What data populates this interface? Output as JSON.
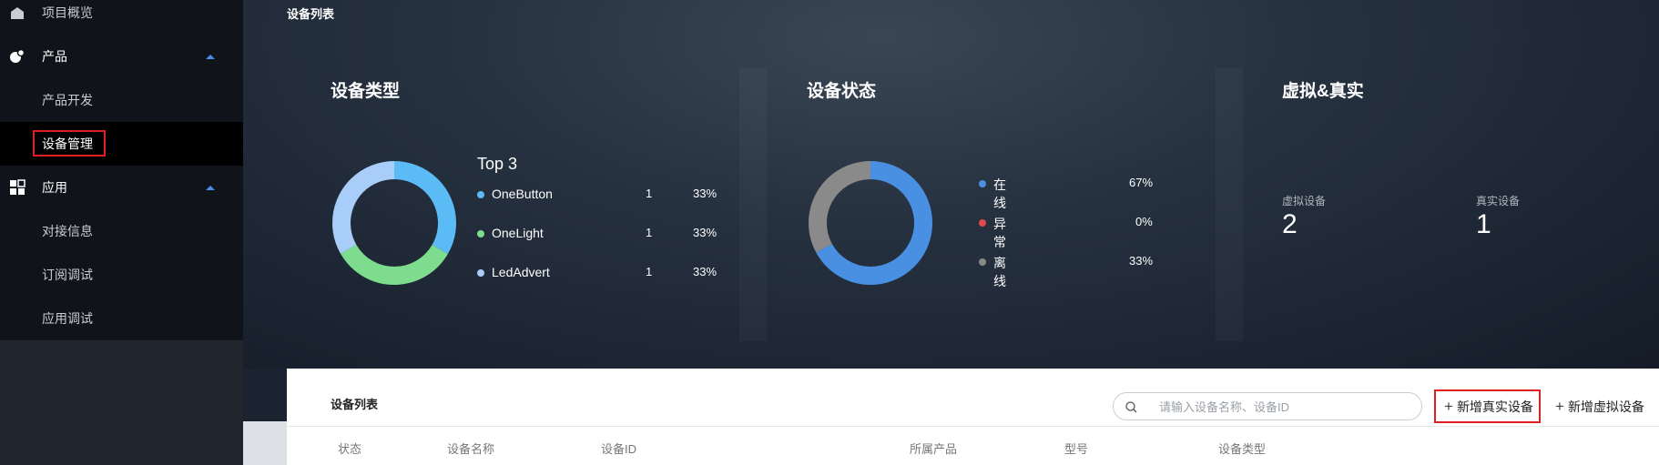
{
  "sidebar": {
    "items": [
      {
        "label": "项目概览",
        "icon": "home-icon",
        "kind": "item"
      },
      {
        "label": "产品",
        "icon": "product-icon",
        "kind": "group"
      },
      {
        "label": "产品开发",
        "kind": "sub"
      },
      {
        "label": "设备管理",
        "kind": "sub",
        "active": true
      },
      {
        "label": "应用",
        "icon": "apps-icon",
        "kind": "group"
      },
      {
        "label": "对接信息",
        "kind": "sub"
      },
      {
        "label": "订阅调试",
        "kind": "sub"
      },
      {
        "label": "应用调试",
        "kind": "sub"
      }
    ]
  },
  "hero": {
    "title": "设备列表",
    "device_type": {
      "title": "设备类型",
      "top_label": "Top 3",
      "legend": [
        {
          "name": "OneButton",
          "count": "1",
          "pct": "33%",
          "color": "#5bbcf5"
        },
        {
          "name": "OneLight",
          "count": "1",
          "pct": "33%",
          "color": "#7edc8e"
        },
        {
          "name": "LedAdvert",
          "count": "1",
          "pct": "33%",
          "color": "#a7cdf8"
        }
      ]
    },
    "device_status": {
      "title": "设备状态",
      "legend": [
        {
          "name": "在线",
          "pct": "67%",
          "color": "#4a90e2"
        },
        {
          "name": "异常",
          "pct": "0%",
          "color": "#e04a4a"
        },
        {
          "name": "离线",
          "pct": "33%",
          "color": "#8a8a8a"
        }
      ]
    },
    "virtual_real": {
      "title": "虚拟&真实",
      "virtual_label": "虚拟设备",
      "virtual_value": "2",
      "real_label": "真实设备",
      "real_value": "1"
    }
  },
  "list": {
    "title": "设备列表",
    "search_placeholder": "请输入设备名称、设备ID",
    "add_real_label": "新增真实设备",
    "add_virtual_label": "新增虚拟设备",
    "columns": [
      "状态",
      "设备名称",
      "设备ID",
      "所属产品",
      "型号",
      "设备类型"
    ]
  },
  "chart_data": [
    {
      "type": "pie",
      "title": "设备类型",
      "categories": [
        "OneButton",
        "OneLight",
        "LedAdvert"
      ],
      "values": [
        1,
        1,
        1
      ],
      "colors": [
        "#5bbcf5",
        "#7edc8e",
        "#a7cdf8"
      ]
    },
    {
      "type": "pie",
      "title": "设备状态",
      "categories": [
        "在线",
        "异常",
        "离线"
      ],
      "values": [
        67,
        0,
        33
      ],
      "colors": [
        "#4a90e2",
        "#e04a4a",
        "#8a8a8a"
      ]
    }
  ]
}
